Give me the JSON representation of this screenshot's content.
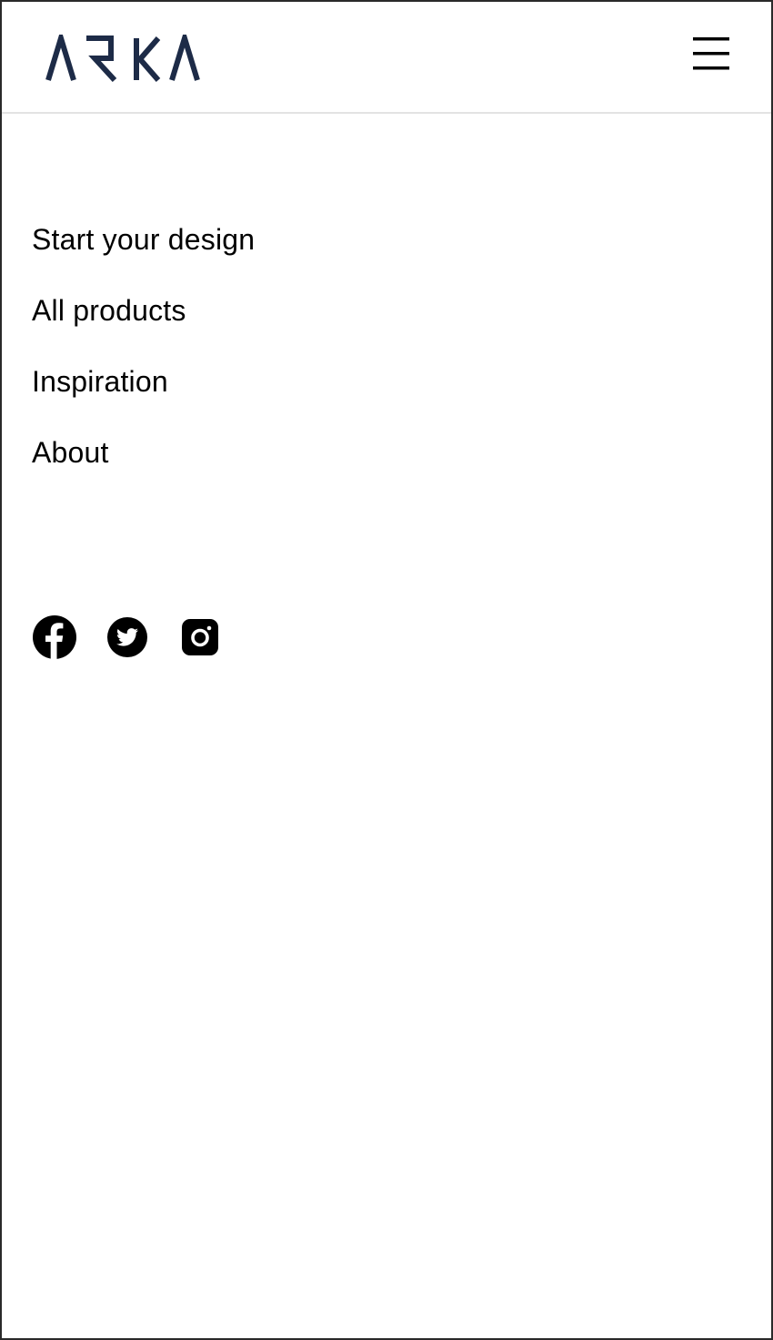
{
  "header": {
    "logo_text": "ARKA",
    "logo_color": "#1d2b47",
    "menu_icon": "hamburger-menu-icon"
  },
  "nav": {
    "items": [
      {
        "label": "Start your design"
      },
      {
        "label": "All products"
      },
      {
        "label": "Inspiration"
      },
      {
        "label": "About"
      }
    ]
  },
  "social": {
    "icons": [
      "facebook-icon",
      "twitter-icon",
      "instagram-icon"
    ]
  },
  "colors": {
    "text": "#000000",
    "header_divider": "#e3e3e3",
    "frame_border": "#2a2a2a"
  }
}
